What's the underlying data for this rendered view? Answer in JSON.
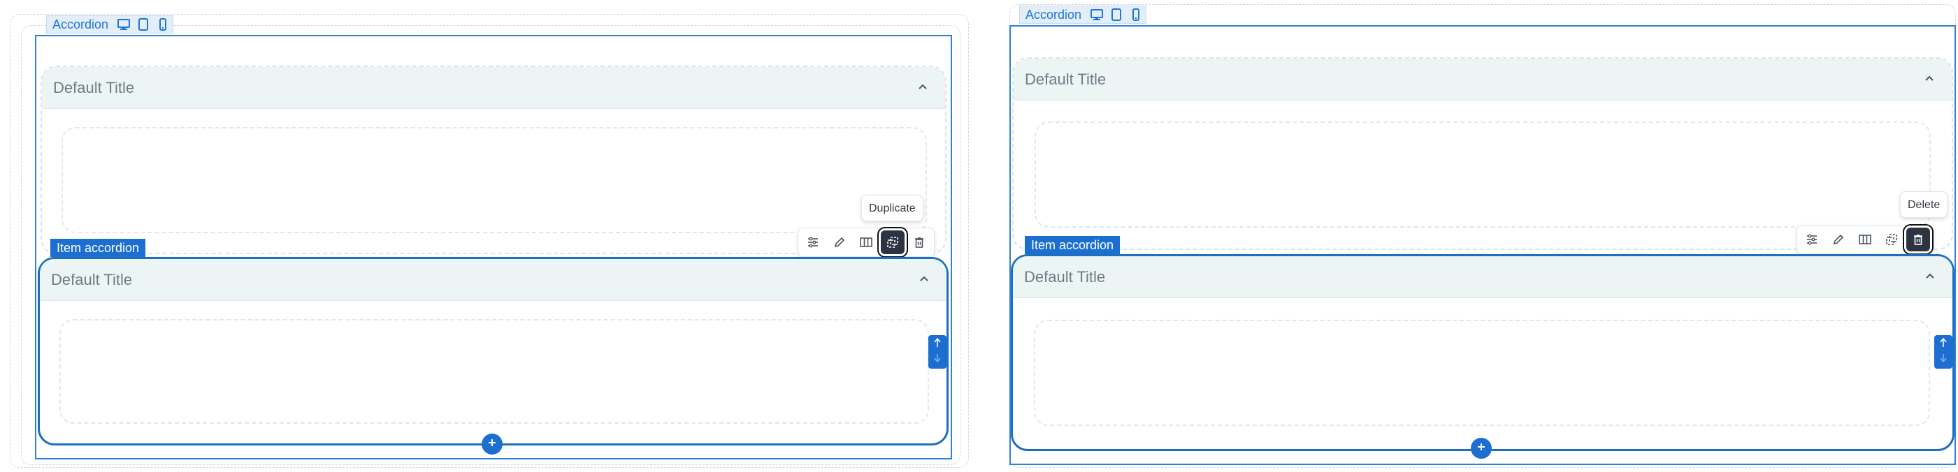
{
  "panels": [
    {
      "block_label": "Accordion",
      "devices": [
        "desktop-icon",
        "tablet-icon",
        "mobile-icon"
      ],
      "items": [
        {
          "title": "Default Title"
        },
        {
          "title": "Default Title"
        }
      ],
      "item_label": "Item accordion",
      "toolbar": [
        "settings-icon",
        "edit-icon",
        "columns-icon",
        "duplicate-icon",
        "delete-icon"
      ],
      "active_tool": "duplicate-icon",
      "tooltip": "Duplicate"
    },
    {
      "block_label": "Accordion",
      "devices": [
        "desktop-icon",
        "tablet-icon",
        "mobile-icon"
      ],
      "items": [
        {
          "title": "Default Title"
        },
        {
          "title": "Default Title"
        }
      ],
      "item_label": "Item accordion",
      "toolbar": [
        "settings-icon",
        "edit-icon",
        "columns-icon",
        "duplicate-icon",
        "delete-icon"
      ],
      "active_tool": "delete-icon",
      "tooltip": "Delete"
    }
  ],
  "colors": {
    "accent": "#1c6fd0",
    "header_bg": "#edf5f4",
    "title_text": "#6f7b86"
  }
}
